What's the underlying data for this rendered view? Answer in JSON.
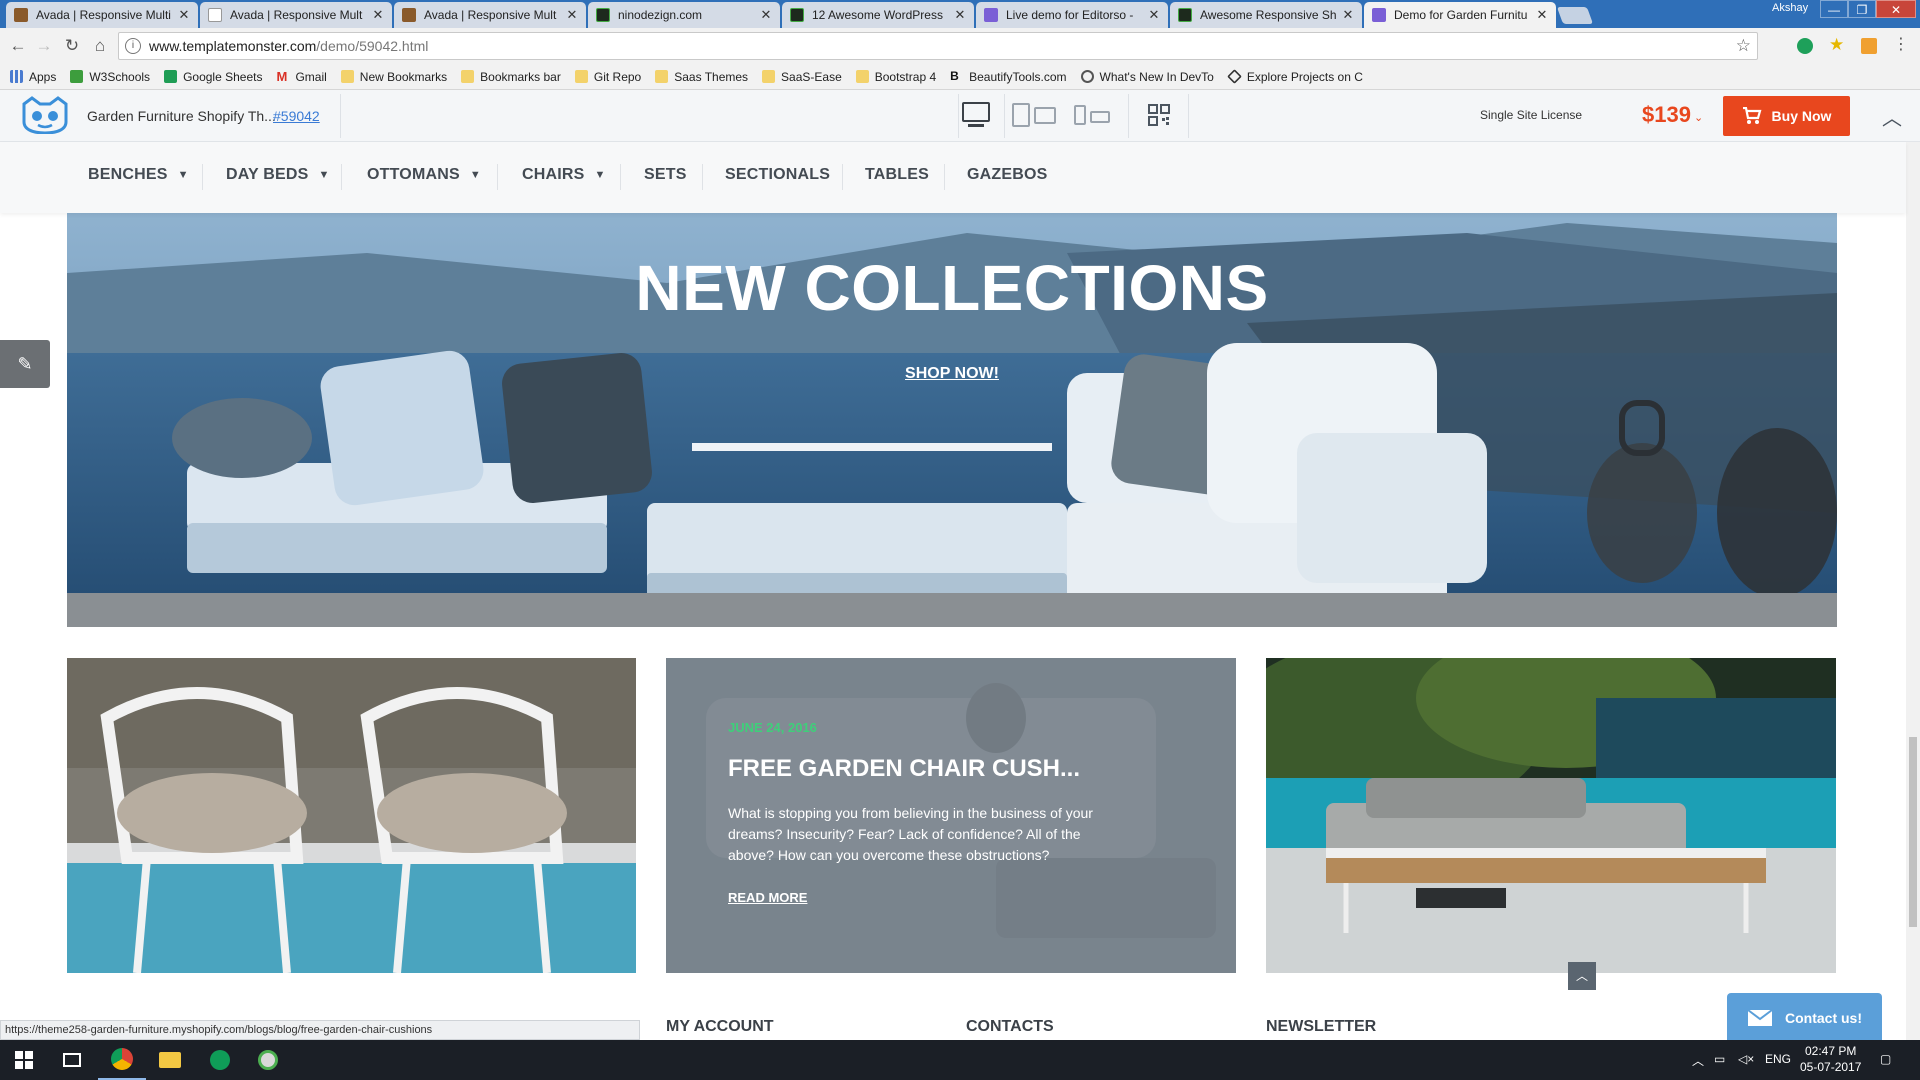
{
  "browser": {
    "tabs": [
      {
        "title": "Avada | Responsive Multi",
        "favicon": "avada-favicon"
      },
      {
        "title": "Avada | Responsive Mult",
        "favicon": "page-favicon"
      },
      {
        "title": "Avada | Responsive Mult",
        "favicon": "avada-favicon"
      },
      {
        "title": "ninodezign.com",
        "favicon": "nino-favicon"
      },
      {
        "title": "12 Awesome WordPress",
        "favicon": "nino-favicon"
      },
      {
        "title": "Live demo for Editorso -",
        "favicon": "tm-favicon"
      },
      {
        "title": "Awesome Responsive Sh",
        "favicon": "nino-favicon"
      },
      {
        "title": "Demo for Garden Furnitu",
        "favicon": "tm-favicon",
        "active": true
      }
    ],
    "profile_name": "Akshay",
    "url_host": "www.templatemonster.com",
    "url_path": "/demo/59042.html",
    "bookmarks": [
      {
        "label": "Apps",
        "icon": "apps-icon"
      },
      {
        "label": "W3Schools",
        "icon": "w3schools-icon"
      },
      {
        "label": "Google Sheets",
        "icon": "sheets-icon"
      },
      {
        "label": "Gmail",
        "icon": "gmail-icon"
      },
      {
        "label": "New Bookmarks",
        "icon": "folder-icon"
      },
      {
        "label": "Bookmarks bar",
        "icon": "folder-icon"
      },
      {
        "label": "Git Repo",
        "icon": "folder-icon"
      },
      {
        "label": "Saas Themes",
        "icon": "folder-icon"
      },
      {
        "label": "SaaS-Ease",
        "icon": "folder-icon"
      },
      {
        "label": "Bootstrap 4",
        "icon": "folder-icon"
      },
      {
        "label": "BeautifyTools.com",
        "icon": "bt-icon"
      },
      {
        "label": "What's New In DevTo",
        "icon": "devtools-icon"
      },
      {
        "label": "Explore Projects on C",
        "icon": "codepen-icon"
      }
    ]
  },
  "demo_bar": {
    "template_name": "Garden Furniture Shopify Th...",
    "template_id": "#59042",
    "license": "Single Site License",
    "price": "$139",
    "buy_label": "Buy Now"
  },
  "site": {
    "nav": [
      {
        "label": "BENCHES",
        "dropdown": true
      },
      {
        "label": "DAY BEDS",
        "dropdown": true
      },
      {
        "label": "OTTOMANS",
        "dropdown": true
      },
      {
        "label": "CHAIRS",
        "dropdown": true
      },
      {
        "label": "SETS",
        "dropdown": false
      },
      {
        "label": "SECTIONALS",
        "dropdown": false
      },
      {
        "label": "TABLES",
        "dropdown": false
      },
      {
        "label": "GAZEBOS",
        "dropdown": false
      }
    ],
    "hero": {
      "title": "NEW COLLECTIONS",
      "cta": "SHOP NOW!"
    },
    "blog": {
      "date": "JUNE 24, 2016",
      "title": "FREE GARDEN CHAIR CUSH...",
      "excerpt": "What is stopping you from believing in the business of your dreams? Insecurity? Fear? Lack of confidence? All of the above? How can you overcome these obstructions?",
      "read_more": "READ MORE"
    },
    "footer_headings": [
      "MY ACCOUNT",
      "CONTACTS",
      "NEWSLETTER"
    ],
    "contact_label": "Contact us!",
    "status_url": "https://theme258-garden-furniture.myshopify.com/blogs/blog/free-garden-chair-cushions"
  },
  "taskbar": {
    "language": "ENG",
    "time": "02:47 PM",
    "date": "05-07-2017"
  },
  "colors": {
    "accent_orange": "#e8471e",
    "blog_date_green": "#3fcf7a",
    "chrome_blue": "#2f6fb8",
    "contact_blue": "#5b9fd9"
  }
}
